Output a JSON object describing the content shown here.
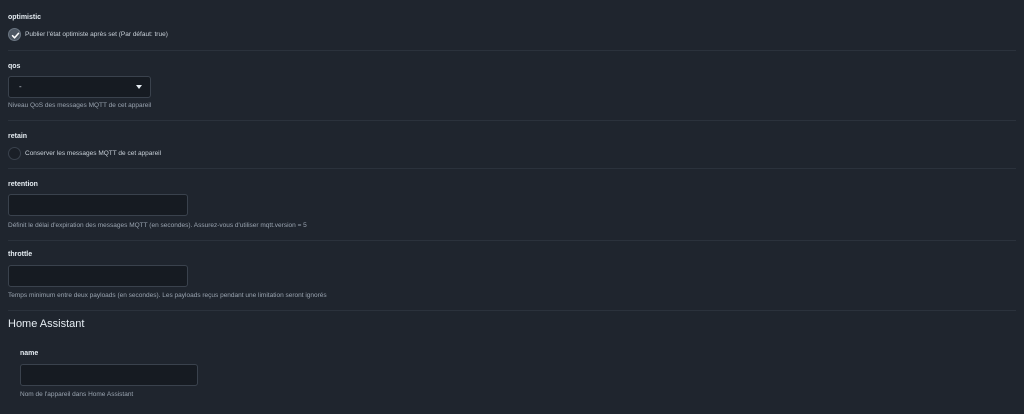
{
  "optimistic": {
    "label": "optimistic",
    "checked": true,
    "checkbox_label": "Publier l'état optimiste après set (Par défaut: true)"
  },
  "qos": {
    "label": "qos",
    "value": "-",
    "help": "Niveau QoS des messages MQTT de cet appareil"
  },
  "retain": {
    "label": "retain",
    "checked": false,
    "checkbox_label": "Conserver les messages MQTT de cet appareil"
  },
  "retention": {
    "label": "retention",
    "value": "",
    "help": "Définit le délai d'expiration des messages MQTT (en secondes). Assurez-vous d'utiliser mqtt.version = 5"
  },
  "throttle": {
    "label": "throttle",
    "value": "",
    "help": "Temps minimum entre deux payloads (en secondes). Les payloads reçus pendant une limitation seront ignorés"
  },
  "home_assistant": {
    "title": "Home Assistant",
    "name": {
      "label": "name",
      "value": "",
      "help": "Nom de l'appareil dans Home Assistant"
    }
  },
  "colors": {
    "background": "#1f252e",
    "input_bg": "#161b22",
    "border": "#3a424d",
    "text": "#c9d1d9"
  }
}
